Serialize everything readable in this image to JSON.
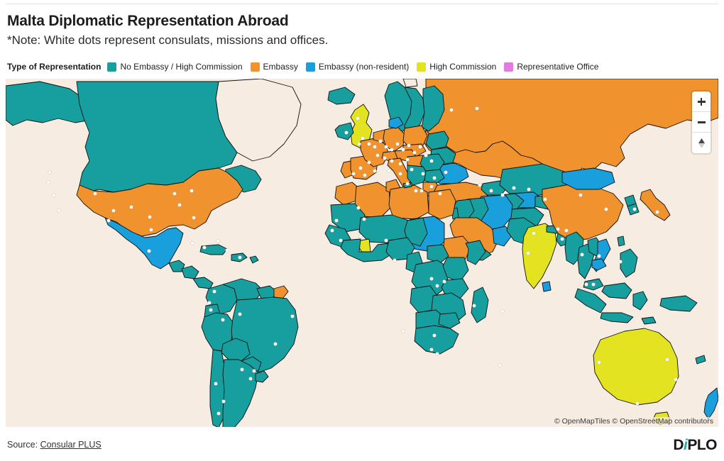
{
  "header": {
    "title": "Malta Diplomatic Representation Abroad",
    "subtitle": "*Note: White dots represent consulats, missions and offices."
  },
  "legend": {
    "title": "Type of Representation",
    "items": [
      {
        "label": "No Embassy / High Commission",
        "color": "#179e9e"
      },
      {
        "label": "Embassy",
        "color": "#f0922e"
      },
      {
        "label": "Embassy (non-resident)",
        "color": "#1a9fdd"
      },
      {
        "label": "High Commission",
        "color": "#e3e322"
      },
      {
        "label": "Representative Office",
        "color": "#e07ce0"
      }
    ]
  },
  "map": {
    "background_color": "#f6ece1",
    "border_color": "#111111",
    "dot_color": "#ffffff",
    "attribution": "© OpenMapTiles © OpenStreetMap contributors",
    "controls": {
      "zoom_in": "+",
      "zoom_out": "−",
      "compass": "compass-north"
    }
  },
  "footer": {
    "source_label": "Source:",
    "source_link": "Consular PLUS",
    "logo": {
      "part1": "D",
      "part2": "i",
      "part3": "PLO"
    }
  },
  "chart_data": {
    "type": "map",
    "title": "Malta Diplomatic Representation Abroad",
    "note": "*Note: White dots represent consulats, missions and offices.",
    "projection": "web-mercator-world",
    "categories": [
      "No Embassy / High Commission",
      "Embassy",
      "Embassy (non-resident)",
      "High Commission",
      "Representative Office"
    ],
    "category_colors": {
      "No Embassy / High Commission": "#179e9e",
      "Embassy": "#f0922e",
      "Embassy (non-resident)": "#1a9fdd",
      "High Commission": "#e3e322",
      "Representative Office": "#e07ce0"
    },
    "examples": {
      "Embassy": [
        "United States",
        "Russia",
        "China",
        "Japan",
        "France",
        "Germany",
        "Italy",
        "Spain",
        "Portugal",
        "Belgium",
        "Netherlands",
        "Poland",
        "Austria",
        "Hungary",
        "Egypt",
        "Libya",
        "Tunisia",
        "Algeria",
        "Morocco",
        "Saudi Arabia",
        "Ethiopia",
        "Turkey",
        "Greece",
        "French Guiana"
      ],
      "High Commission": [
        "United Kingdom",
        "India",
        "Australia",
        "Ghana"
      ],
      "Embassy (non-resident)": [
        "Mexico",
        "Mongolia",
        "Sudan",
        "Ukraine",
        "Iran",
        "Uzbekistan",
        "Denmark",
        "Netherlands Antilles"
      ],
      "No Embassy / High Commission": [
        "Canada",
        "Brazil",
        "Argentina",
        "Chile",
        "Peru",
        "Colombia",
        "South Africa",
        "Kenya",
        "Nigeria",
        "Indonesia",
        "Kazakhstan",
        "Norway",
        "Sweden",
        "Finland",
        "Romania",
        "Bulgaria"
      ]
    }
  }
}
